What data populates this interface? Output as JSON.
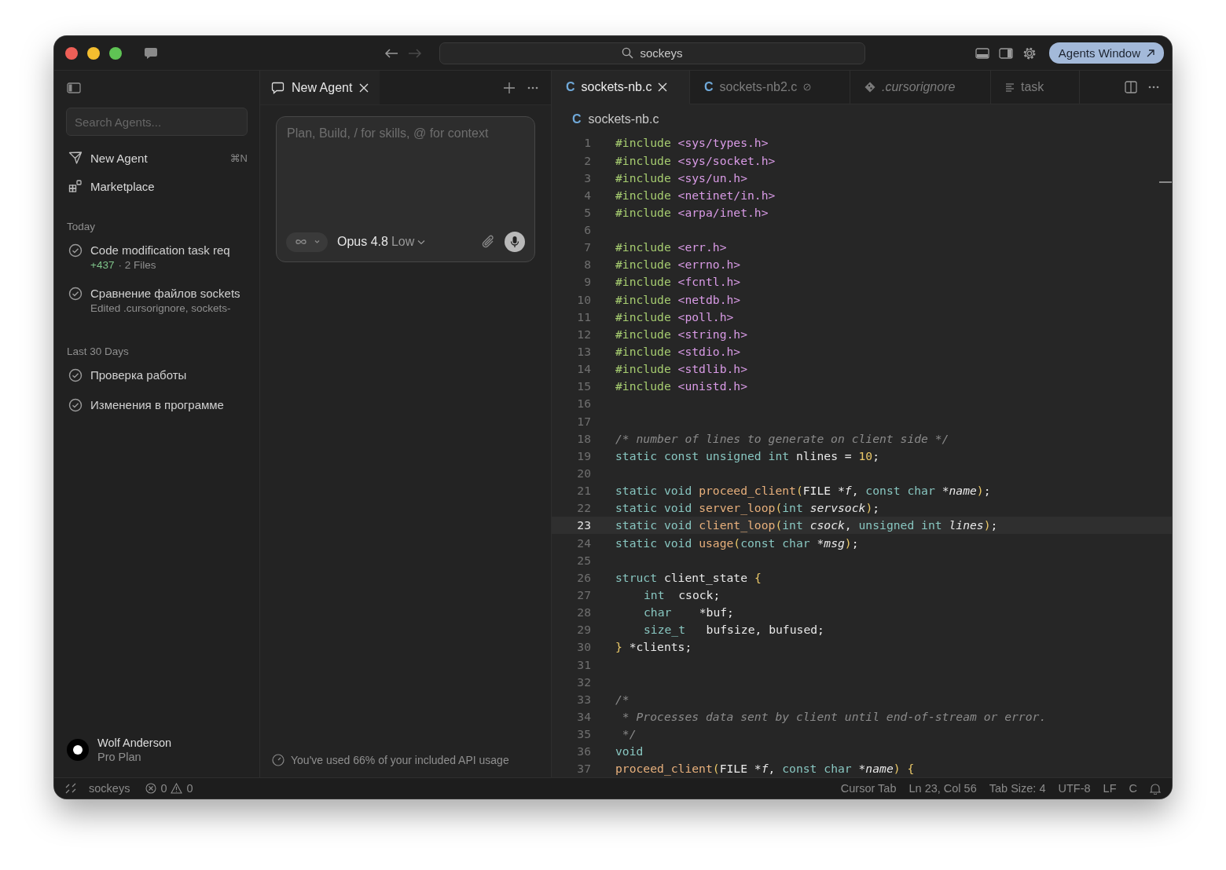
{
  "titlebar": {
    "search": "sockeys",
    "agents_button": "Agents Window"
  },
  "sidebar": {
    "search_placeholder": "Search Agents...",
    "actions": [
      {
        "kind": "new",
        "label": "New Agent",
        "shortcut": "⌘N"
      },
      {
        "kind": "market",
        "label": "Marketplace"
      }
    ],
    "groups": [
      {
        "heading": "Today",
        "items": [
          {
            "title": "Code modification task req",
            "added": "+437",
            "detail": "· 2 Files",
            "done": true
          },
          {
            "title": "Сравнение файлов sockets",
            "detail": "Edited .cursorignore, sockets-",
            "done": true
          }
        ]
      },
      {
        "heading": "Last 30 Days",
        "items": [
          {
            "title": "Проверка работы",
            "done": true
          },
          {
            "title": "Изменения в программе",
            "done": true
          }
        ]
      }
    ],
    "user": {
      "name": "Wolf Anderson",
      "plan": "Pro Plan"
    }
  },
  "agent": {
    "tab": "New Agent",
    "placeholder": "Plan, Build, / for skills, @ for context",
    "model": "Opus 4.8",
    "effort": "Low",
    "usage": "You've used 66% of your included API usage"
  },
  "editor": {
    "tabs": [
      {
        "kind": "c",
        "badge": "C",
        "label": "sockets-nb.c",
        "selected": true,
        "deleted": false
      },
      {
        "kind": "c",
        "badge": "C",
        "label": "sockets-nb2.c",
        "selected": false,
        "deleted": true
      },
      {
        "kind": "git",
        "label": ".cursorignore",
        "selected": false,
        "deleted": false
      },
      {
        "kind": "text",
        "label": "task",
        "selected": false,
        "deleted": false
      }
    ],
    "breadcrumb": {
      "badge": "C",
      "label": "sockets-nb.c"
    },
    "lines": [
      {
        "n": "1",
        "current": false,
        "t": [
          {
            "kind": "pp",
            "text": "#include "
          },
          {
            "kind": "hdr",
            "text": "<sys/types.h>"
          }
        ]
      },
      {
        "n": "2",
        "current": false,
        "t": [
          {
            "kind": "pp",
            "text": "#include "
          },
          {
            "kind": "hdr",
            "text": "<sys/socket.h>"
          }
        ]
      },
      {
        "n": "3",
        "current": false,
        "t": [
          {
            "kind": "pp",
            "text": "#include "
          },
          {
            "kind": "hdr",
            "text": "<sys/un.h>"
          }
        ]
      },
      {
        "n": "4",
        "current": false,
        "t": [
          {
            "kind": "pp",
            "text": "#include "
          },
          {
            "kind": "hdr",
            "text": "<netinet/in.h>"
          }
        ]
      },
      {
        "n": "5",
        "current": false,
        "t": [
          {
            "kind": "pp",
            "text": "#include "
          },
          {
            "kind": "hdr",
            "text": "<arpa/inet.h>"
          }
        ]
      },
      {
        "n": "6",
        "current": false
      },
      {
        "n": "7",
        "current": false,
        "t": [
          {
            "kind": "pp",
            "text": "#include "
          },
          {
            "kind": "hdr",
            "text": "<err.h>"
          }
        ]
      },
      {
        "n": "8",
        "current": false,
        "t": [
          {
            "kind": "pp",
            "text": "#include "
          },
          {
            "kind": "hdr",
            "text": "<errno.h>"
          }
        ]
      },
      {
        "n": "9",
        "current": false,
        "t": [
          {
            "kind": "pp",
            "text": "#include "
          },
          {
            "kind": "hdr",
            "text": "<fcntl.h>"
          }
        ]
      },
      {
        "n": "10",
        "current": false,
        "t": [
          {
            "kind": "pp",
            "text": "#include "
          },
          {
            "kind": "hdr",
            "text": "<netdb.h>"
          }
        ]
      },
      {
        "n": "11",
        "current": false,
        "t": [
          {
            "kind": "pp",
            "text": "#include "
          },
          {
            "kind": "hdr",
            "text": "<poll.h>"
          }
        ]
      },
      {
        "n": "12",
        "current": false,
        "t": [
          {
            "kind": "pp",
            "text": "#include "
          },
          {
            "kind": "hdr",
            "text": "<string.h>"
          }
        ]
      },
      {
        "n": "13",
        "current": false,
        "t": [
          {
            "kind": "pp",
            "text": "#include "
          },
          {
            "kind": "hdr",
            "text": "<stdio.h>"
          }
        ]
      },
      {
        "n": "14",
        "current": false,
        "t": [
          {
            "kind": "pp",
            "text": "#include "
          },
          {
            "kind": "hdr",
            "text": "<stdlib.h>"
          }
        ]
      },
      {
        "n": "15",
        "current": false,
        "t": [
          {
            "kind": "pp",
            "text": "#include "
          },
          {
            "kind": "hdr",
            "text": "<unistd.h>"
          }
        ]
      },
      {
        "n": "16",
        "current": false
      },
      {
        "n": "17",
        "current": false
      },
      {
        "n": "18",
        "current": false,
        "t": [
          {
            "kind": "cm",
            "text": "/* number of lines to generate on client side */"
          }
        ]
      },
      {
        "n": "19",
        "current": false,
        "t": [
          {
            "kind": "kw",
            "text": "static const unsigned int"
          },
          {
            "kind": "tx",
            "text": " nlines = "
          },
          {
            "kind": "num",
            "text": "10"
          },
          {
            "kind": "tx",
            "text": ";"
          }
        ]
      },
      {
        "n": "20",
        "current": false
      },
      {
        "n": "21",
        "current": false,
        "t": [
          {
            "kind": "kw",
            "text": "static void "
          },
          {
            "kind": "fn",
            "text": "proceed_client"
          },
          {
            "kind": "br",
            "text": "("
          },
          {
            "kind": "tx",
            "text": "FILE "
          },
          {
            "kind": "it",
            "text": "*f"
          },
          {
            "kind": "tx",
            "text": ", "
          },
          {
            "kind": "kw",
            "text": "const char "
          },
          {
            "kind": "it",
            "text": "*name"
          },
          {
            "kind": "br",
            "text": ")"
          },
          {
            "kind": "tx",
            "text": ";"
          }
        ]
      },
      {
        "n": "22",
        "current": false,
        "t": [
          {
            "kind": "kw",
            "text": "static void "
          },
          {
            "kind": "fn",
            "text": "server_loop"
          },
          {
            "kind": "br",
            "text": "("
          },
          {
            "kind": "kw",
            "text": "int "
          },
          {
            "kind": "it",
            "text": "servsock"
          },
          {
            "kind": "br",
            "text": ")"
          },
          {
            "kind": "tx",
            "text": ";"
          }
        ]
      },
      {
        "n": "23",
        "current": true,
        "t": [
          {
            "kind": "kw",
            "text": "static void "
          },
          {
            "kind": "fn",
            "text": "client_loop"
          },
          {
            "kind": "br",
            "text": "("
          },
          {
            "kind": "kw",
            "text": "int "
          },
          {
            "kind": "it",
            "text": "csock"
          },
          {
            "kind": "tx",
            "text": ", "
          },
          {
            "kind": "kw",
            "text": "unsigned int "
          },
          {
            "kind": "it",
            "text": "lines"
          },
          {
            "kind": "br",
            "text": ")"
          },
          {
            "kind": "tx",
            "text": ";"
          }
        ]
      },
      {
        "n": "24",
        "current": false,
        "t": [
          {
            "kind": "kw",
            "text": "static void "
          },
          {
            "kind": "fn",
            "text": "usage"
          },
          {
            "kind": "br",
            "text": "("
          },
          {
            "kind": "kw",
            "text": "const char "
          },
          {
            "kind": "it",
            "text": "*msg"
          },
          {
            "kind": "br",
            "text": ")"
          },
          {
            "kind": "tx",
            "text": ";"
          }
        ]
      },
      {
        "n": "25",
        "current": false
      },
      {
        "n": "26",
        "current": false,
        "t": [
          {
            "kind": "kw",
            "text": "struct "
          },
          {
            "kind": "tx",
            "text": "client_state "
          },
          {
            "kind": "br",
            "text": "{"
          }
        ]
      },
      {
        "n": "27",
        "current": false,
        "indent": true,
        "t": [
          {
            "kind": "kw",
            "text": "int"
          },
          {
            "kind": "tx",
            "text": "  csock;"
          }
        ]
      },
      {
        "n": "28",
        "current": false,
        "indent": true,
        "t": [
          {
            "kind": "kw",
            "text": "char"
          },
          {
            "kind": "tx",
            "text": "    *buf;"
          }
        ]
      },
      {
        "n": "29",
        "current": false,
        "indent": true,
        "t": [
          {
            "kind": "kw",
            "text": "size_t"
          },
          {
            "kind": "tx",
            "text": "   bufsize, bufused;"
          }
        ]
      },
      {
        "n": "30",
        "current": false,
        "t": [
          {
            "kind": "br",
            "text": "}"
          },
          {
            "kind": "tx",
            "text": " *clients;"
          }
        ]
      },
      {
        "n": "31",
        "current": false
      },
      {
        "n": "32",
        "current": false
      },
      {
        "n": "33",
        "current": false,
        "t": [
          {
            "kind": "cm",
            "text": "/*"
          }
        ]
      },
      {
        "n": "34",
        "current": false,
        "t": [
          {
            "kind": "cm",
            "text": " * Processes data sent by client until end-of-stream or error."
          }
        ]
      },
      {
        "n": "35",
        "current": false,
        "t": [
          {
            "kind": "cm",
            "text": " */"
          }
        ]
      },
      {
        "n": "36",
        "current": false,
        "t": [
          {
            "kind": "kw",
            "text": "void"
          }
        ]
      },
      {
        "n": "37",
        "current": false,
        "t": [
          {
            "kind": "fn",
            "text": "proceed_client"
          },
          {
            "kind": "br",
            "text": "("
          },
          {
            "kind": "tx",
            "text": "FILE "
          },
          {
            "kind": "it",
            "text": "*f"
          },
          {
            "kind": "tx",
            "text": ", "
          },
          {
            "kind": "kw",
            "text": "const char "
          },
          {
            "kind": "it",
            "text": "*name"
          },
          {
            "kind": "br",
            "text": ")"
          },
          {
            "kind": "br",
            "text": " {"
          }
        ]
      }
    ]
  },
  "status_bar": {
    "project": "sockeys",
    "errors": "0",
    "warnings": "0",
    "items": [
      "Cursor Tab",
      "Ln 23, Col 56",
      "Tab Size: 4",
      "UTF-8",
      "LF",
      "C"
    ]
  }
}
